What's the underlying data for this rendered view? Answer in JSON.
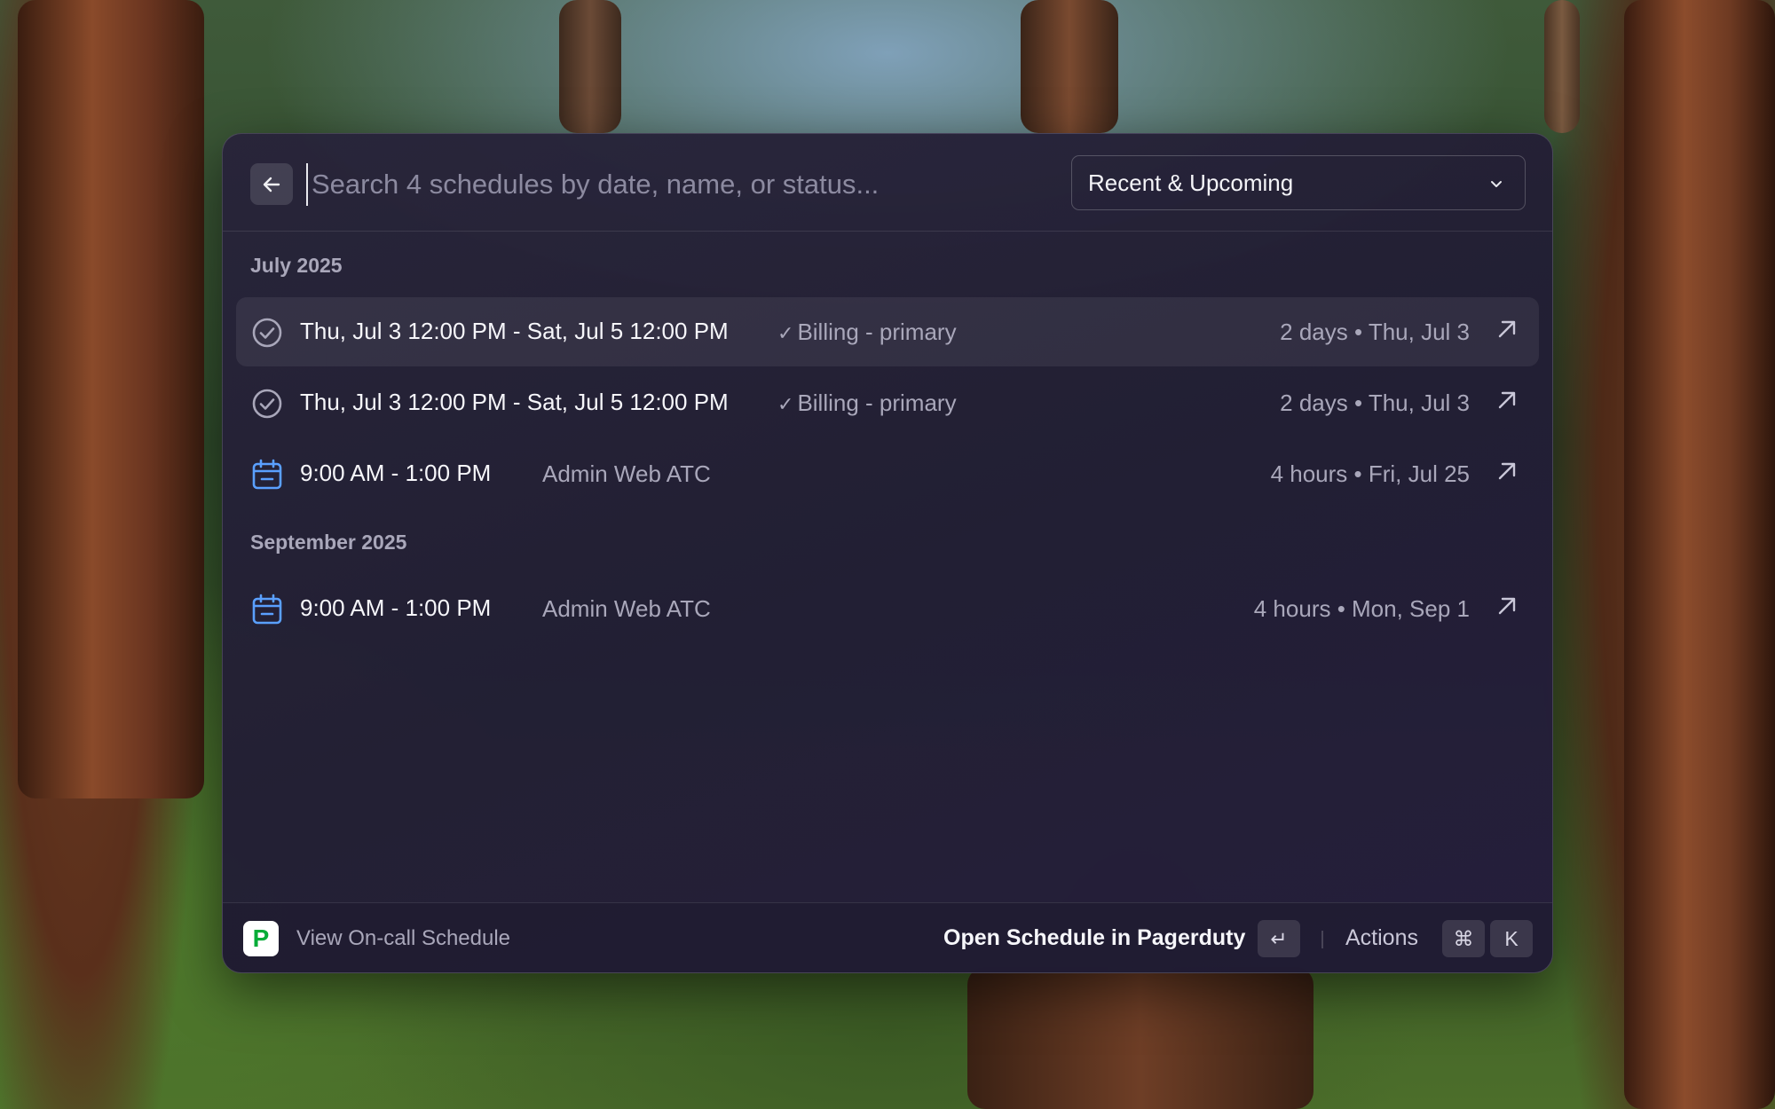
{
  "search": {
    "placeholder": "Search 4 schedules by date, name, or status...",
    "value": ""
  },
  "filter": {
    "selected": "Recent & Upcoming"
  },
  "sections": [
    {
      "heading": "July 2025",
      "rows": [
        {
          "icon": "check-circle-icon",
          "title": "Thu, Jul 3 12:00 PM - Sat, Jul 5 12:00 PM",
          "subtitle_check": "✓",
          "subtitle": "Billing - primary",
          "meta": "2 days • Thu, Jul 3",
          "selected": true
        },
        {
          "icon": "check-circle-icon",
          "title": "Thu, Jul 3 12:00 PM - Sat, Jul 5 12:00 PM",
          "subtitle_check": "✓",
          "subtitle": "Billing - primary",
          "meta": "2 days • Thu, Jul 3",
          "selected": false
        },
        {
          "icon": "calendar-icon",
          "title": "9:00 AM - 1:00 PM",
          "subtitle_check": "",
          "subtitle": "Admin Web ATC",
          "meta": "4 hours • Fri, Jul 25",
          "selected": false
        }
      ]
    },
    {
      "heading": "September 2025",
      "rows": [
        {
          "icon": "calendar-icon",
          "title": "9:00 AM - 1:00 PM",
          "subtitle_check": "",
          "subtitle": "Admin Web ATC",
          "meta": "4 hours • Mon, Sep 1",
          "selected": false
        }
      ]
    }
  ],
  "footer": {
    "logo_letter": "P",
    "title": "View On-call Schedule",
    "primary_action": "Open Schedule in Pagerduty",
    "enter_key": "↵",
    "actions_label": "Actions",
    "cmd_key": "⌘",
    "k_key": "K"
  },
  "colors": {
    "calendar_icon": "#5aa0ff",
    "check_icon": "#a9a7ba",
    "pagerduty_green": "#06ac38"
  }
}
